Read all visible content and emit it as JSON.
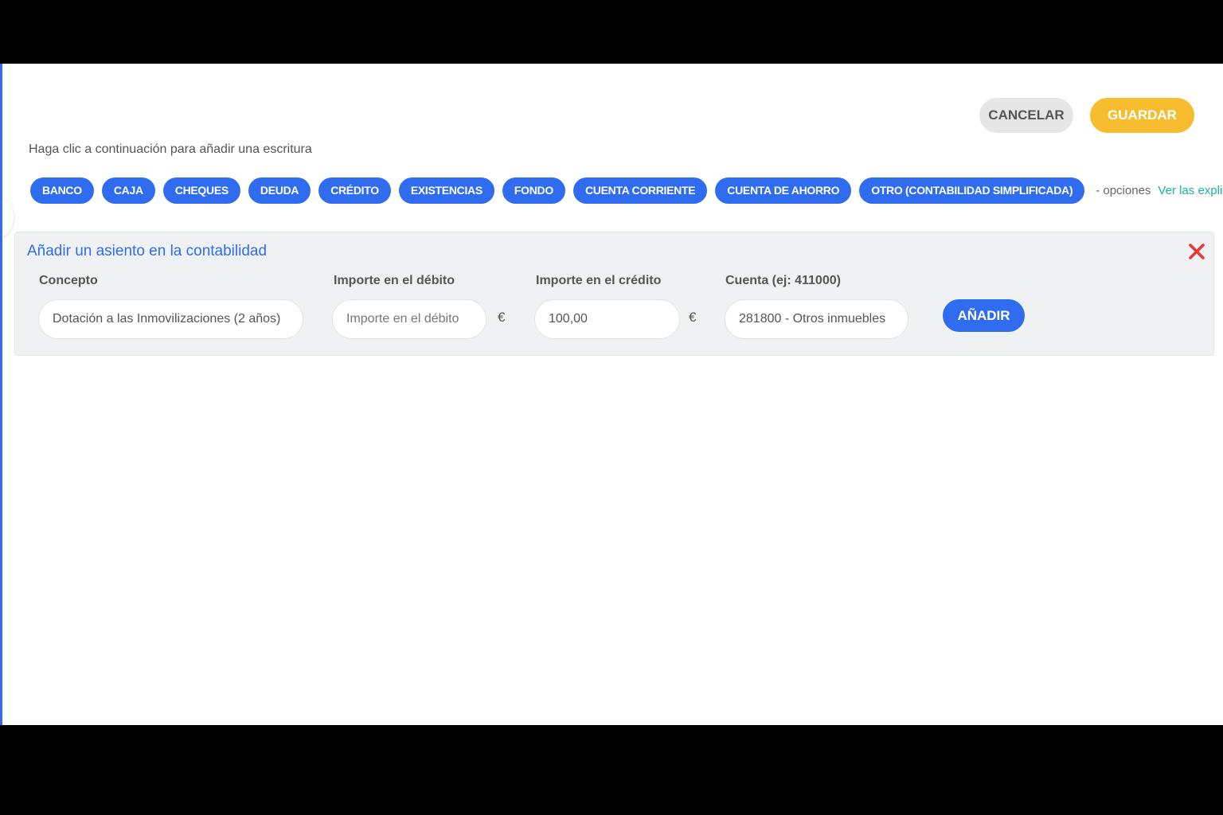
{
  "header": {
    "cancel_label": "CANCELAR",
    "save_label": "GUARDAR"
  },
  "instruction": "Haga clic a continuación para añadir una escritura",
  "chips": [
    "BANCO",
    "CAJA",
    "CHEQUES",
    "DEUDA",
    "CRÉDITO",
    "EXISTENCIAS",
    "FONDO",
    "CUENTA CORRIENTE",
    "CUENTA DE AHORRO",
    "OTRO (CONTABILIDAD SIMPLIFICADA)"
  ],
  "options_text": "- opciones",
  "explain_link": "Ver las explicaciones",
  "entry": {
    "title": "Añadir un asiento en la contabilidad",
    "concept": {
      "label": "Concepto",
      "value": "Dotación a las Inmovilizaciones (2 años)"
    },
    "debit": {
      "label": "Importe en el débito",
      "value": "",
      "placeholder": "Importe en el débito"
    },
    "credit": {
      "label": "Importe en el crédito",
      "value": "100,00"
    },
    "currency": "€",
    "account": {
      "label": "Cuenta (ej: 411000)",
      "value": "281800 - Otros inmuebles"
    },
    "add_label": "AÑADIR"
  },
  "colors": {
    "primary": "#2f6cf0",
    "save": "#f7bd2f",
    "cancel_bg": "#e6e6e6",
    "link": "#1bb3a0",
    "close": "#e53935",
    "panel_bg": "#f0f1f3"
  },
  "icons": {
    "close": "close-icon"
  }
}
